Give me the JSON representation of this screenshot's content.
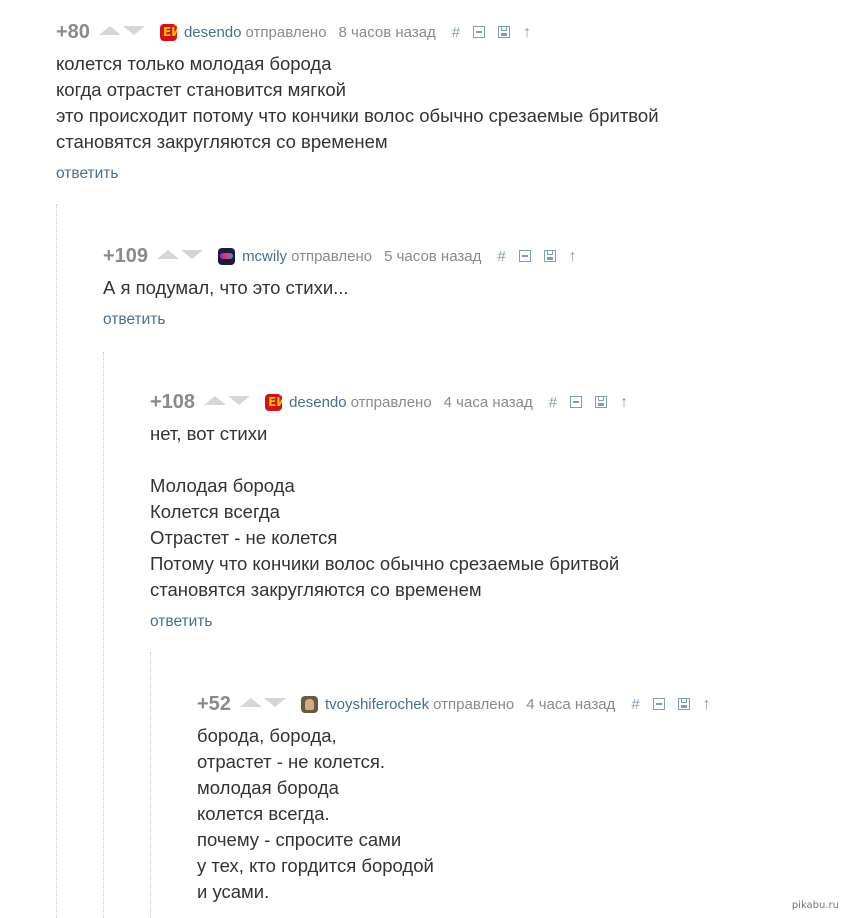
{
  "comments": [
    {
      "rating": "+80",
      "username": "desendo",
      "sent_label": "отправлено",
      "time": "8 часов назад",
      "hash": "#",
      "body": "колется только молодая борода\nкогда отрастет становится мягкой\nэто происходит потому что кончики волос обычно срезаемые бритвой\nстановятся закругляются со временем",
      "reply_label": "ответить",
      "avatar_icon": "desendo-avatar-icon"
    },
    {
      "rating": "+109",
      "username": "mcwily",
      "sent_label": "отправлено",
      "time": "5 часов назад",
      "hash": "#",
      "body": "А я подумал, что это стихи...",
      "reply_label": "ответить",
      "avatar_icon": "mcwily-avatar-icon"
    },
    {
      "rating": "+108",
      "username": "desendo",
      "sent_label": "отправлено",
      "time": "4 часа назад",
      "hash": "#",
      "body": "нет, вот стихи\n\nМолодая борода\nКолется всегда\nОтрастет - не колется\nПотому что кончики волос обычно срезаемые бритвой\nстановятся закругляются со временем",
      "reply_label": "ответить",
      "avatar_icon": "desendo-avatar-icon"
    },
    {
      "rating": "+52",
      "username": "tvoyshiferochek",
      "sent_label": "отправлено",
      "time": "4 часа назад",
      "hash": "#",
      "body": "борода, борода,\nотрастет - не колется.\nмолодая борода\nколется всегда.\nпочему - спросите сами\nу тех, кто гордится бородой\nи усами.",
      "avatar_icon": "tvoyshiferochek-avatar-icon"
    }
  ],
  "watermark": "pikabu.ru",
  "colors": {
    "username": "#4a6f8e",
    "meta": "#8a8a8a",
    "text": "#333333",
    "tool": "#7f9db4"
  }
}
